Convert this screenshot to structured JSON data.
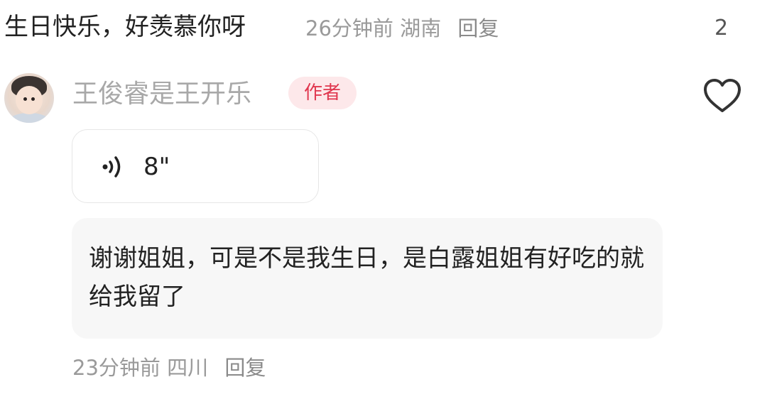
{
  "top_comment": {
    "text": "生日快乐，好羡慕你呀",
    "time": "26分钟前",
    "location": "湖南",
    "reply_label": "回复",
    "like_count": "2"
  },
  "reply": {
    "username": "王俊睿是王开乐",
    "badge": "作者",
    "voice_duration": "8\"",
    "text": "谢谢姐姐，可是不是我生日，是白露姐姐有好吃的就给我留了",
    "time": "23分钟前",
    "location": "四川",
    "reply_label": "回复"
  },
  "colors": {
    "badge_text": "#e0364e",
    "badge_bg": "#fde8ea",
    "meta_text": "#9a9a9a",
    "username": "#a8a8a8"
  }
}
